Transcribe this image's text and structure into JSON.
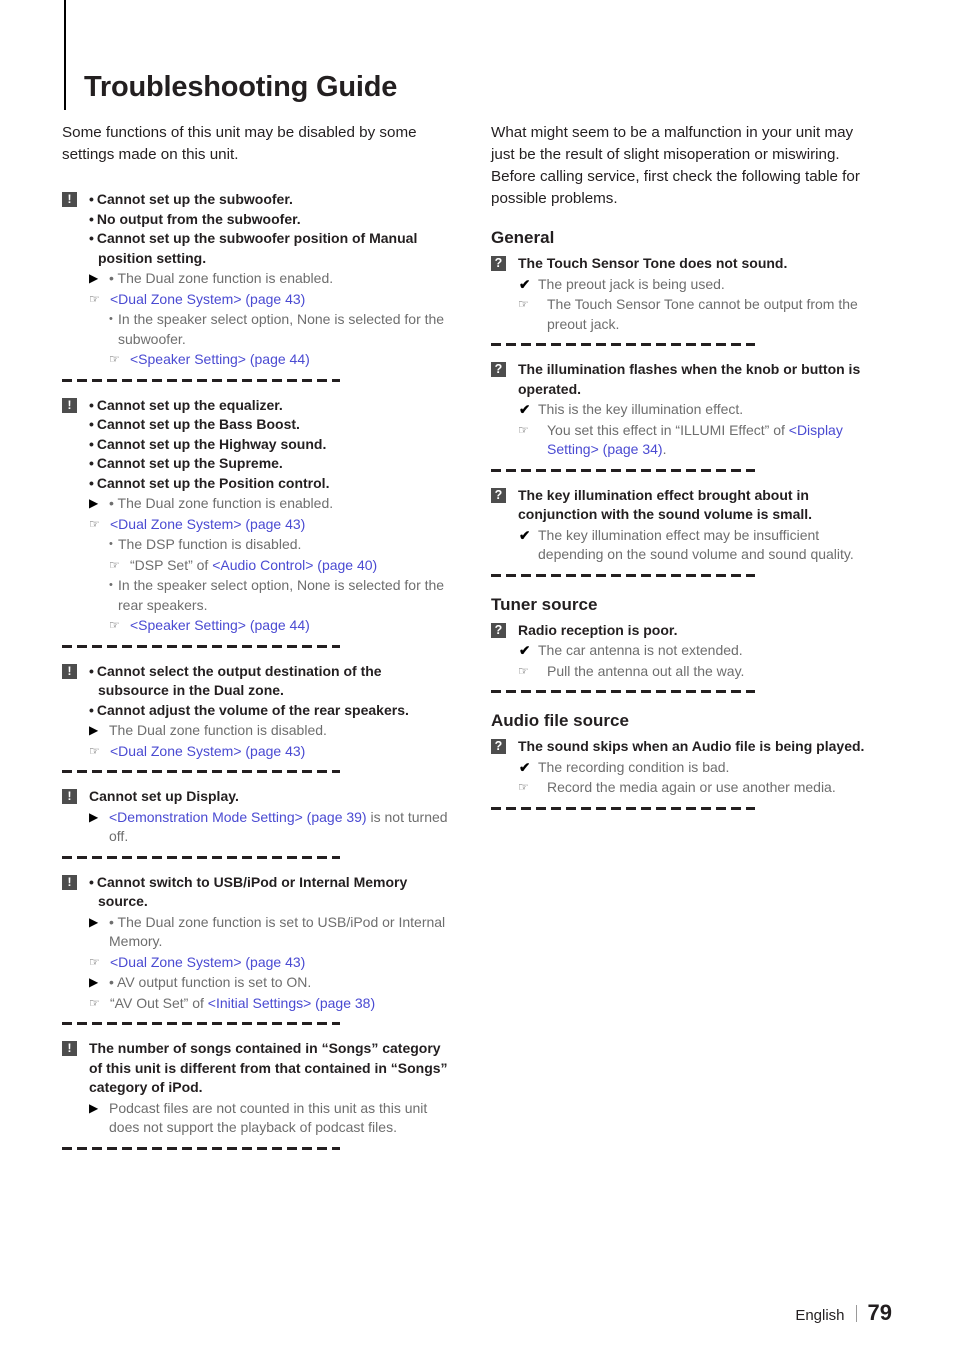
{
  "page": {
    "title": "Troubleshooting Guide",
    "footer_language": "English",
    "footer_page_number": "79",
    "link_color": "#4a4ad2",
    "badge_color": "#4d4d4d",
    "body_color": "#6e6e6e"
  },
  "left": {
    "intro": "Some functions of this unit may be disabled by some settings made on this unit.",
    "entries": [
      {
        "badge": "!",
        "symptoms": [
          "Cannot set up the subwoofer.",
          "No output from the subwoofer.",
          "Cannot set up the subwoofer position of Manual position setting."
        ],
        "cause_marker": "triangle",
        "causes": [
          {
            "text": "The Dual zone function is enabled.",
            "ref_prefix": "",
            "ref_link": "<Dual Zone System> (page 43)",
            "ref_suffix": ""
          },
          {
            "text": "In the speaker select option, None is selected for the subwoofer.",
            "ref_prefix": "",
            "ref_link": "<Speaker Setting> (page 44)",
            "ref_suffix": ""
          }
        ]
      },
      {
        "badge": "!",
        "symptoms": [
          "Cannot set up the equalizer.",
          "Cannot set up the Bass Boost.",
          "Cannot set up the Highway sound.",
          "Cannot set up the Supreme.",
          "Cannot set up the Position control."
        ],
        "cause_marker": "triangle",
        "causes": [
          {
            "text": "The Dual zone function is enabled.",
            "ref_prefix": "",
            "ref_link": "<Dual Zone System> (page 43)",
            "ref_suffix": ""
          },
          {
            "text": "The DSP function is disabled.",
            "ref_prefix": "“DSP Set” of ",
            "ref_link": "<Audio Control> (page 40)",
            "ref_suffix": ""
          },
          {
            "text": "In the speaker select option, None is selected for the rear speakers.",
            "ref_prefix": "",
            "ref_link": "<Speaker Setting> (page 44)",
            "ref_suffix": ""
          }
        ]
      },
      {
        "badge": "!",
        "symptoms": [
          "Cannot select the output destination of the subsource in the Dual zone.",
          "Cannot adjust the volume of the rear speakers."
        ],
        "cause_marker": "triangle",
        "causes": [
          {
            "text": "The Dual zone function is disabled.",
            "ref_prefix": "",
            "ref_link": "<Dual Zone System> (page 43)",
            "ref_suffix": ""
          }
        ]
      },
      {
        "badge": "!",
        "symptoms": [
          "Cannot set up Display."
        ],
        "cause_marker": "triangle",
        "causes": [
          {
            "text": "",
            "inline_prefix": "",
            "inline_link": "<Demonstration Mode Setting> (page 39)",
            "inline_suffix": " is not turned off."
          }
        ]
      },
      {
        "badge": "!",
        "symptoms": [
          "Cannot switch to USB/iPod or Internal Memory source."
        ],
        "cause_marker": "triangle",
        "causes": [
          {
            "text": "The Dual zone function is set to USB/iPod or Internal Memory.",
            "ref_prefix": "",
            "ref_link": "<Dual Zone System> (page 43)",
            "ref_suffix": ""
          },
          {
            "text": "AV output function is set to ON.",
            "ref_prefix": "“AV Out Set” of ",
            "ref_link": "<Initial Settings> (page 38)",
            "ref_suffix": ""
          }
        ]
      },
      {
        "badge": "!",
        "symptoms": [
          "The number of songs contained in “Songs” category of this unit is different from that contained in “Songs” category of iPod."
        ],
        "cause_marker": "triangle",
        "causes": [
          {
            "text": "Podcast files are not counted in this unit as this unit does not support the playback of podcast files."
          }
        ]
      }
    ]
  },
  "right": {
    "intro": "What might seem to be a malfunction in your unit may just be the result of slight misoperation or miswiring. Before calling service, first check the following table for possible problems.",
    "sections": [
      {
        "heading": "General",
        "entries": [
          {
            "badge": "?",
            "symptoms": [
              "The Touch Sensor Tone does not sound."
            ],
            "cause_marker": "check",
            "causes": [
              {
                "text": "The preout jack is being used.",
                "ref_plain": "The Touch Sensor Tone cannot be output from the preout jack."
              }
            ]
          },
          {
            "badge": "?",
            "symptoms": [
              "The illumination flashes when the knob or button is operated."
            ],
            "cause_marker": "check",
            "causes": [
              {
                "text": "This is the key illumination effect.",
                "ref_prefix": "You set this effect in “ILLUMI Effect” of ",
                "ref_link": "<Display Setting> (page 34)",
                "ref_suffix": "."
              }
            ]
          },
          {
            "badge": "?",
            "symptoms": [
              "The key illumination effect brought about in conjunction with the sound volume is small."
            ],
            "cause_marker": "check",
            "causes": [
              {
                "text": "The key illumination effect may be insufficient depending on the sound volume and sound quality."
              }
            ]
          }
        ]
      },
      {
        "heading": "Tuner source",
        "entries": [
          {
            "badge": "?",
            "symptoms": [
              "Radio reception is poor."
            ],
            "cause_marker": "check",
            "causes": [
              {
                "text": "The car antenna is not extended.",
                "ref_plain": "Pull the antenna out all the way."
              }
            ]
          }
        ]
      },
      {
        "heading": "Audio file source",
        "entries": [
          {
            "badge": "?",
            "symptoms": [
              "The sound skips when an Audio file is being played."
            ],
            "cause_marker": "check",
            "causes": [
              {
                "text": "The recording condition is bad.",
                "ref_plain": "Record the media again or use another media."
              }
            ]
          }
        ]
      }
    ]
  },
  "icons": {
    "triangle": "▶",
    "check": "✔",
    "hand": "☞",
    "bullet": "•"
  }
}
